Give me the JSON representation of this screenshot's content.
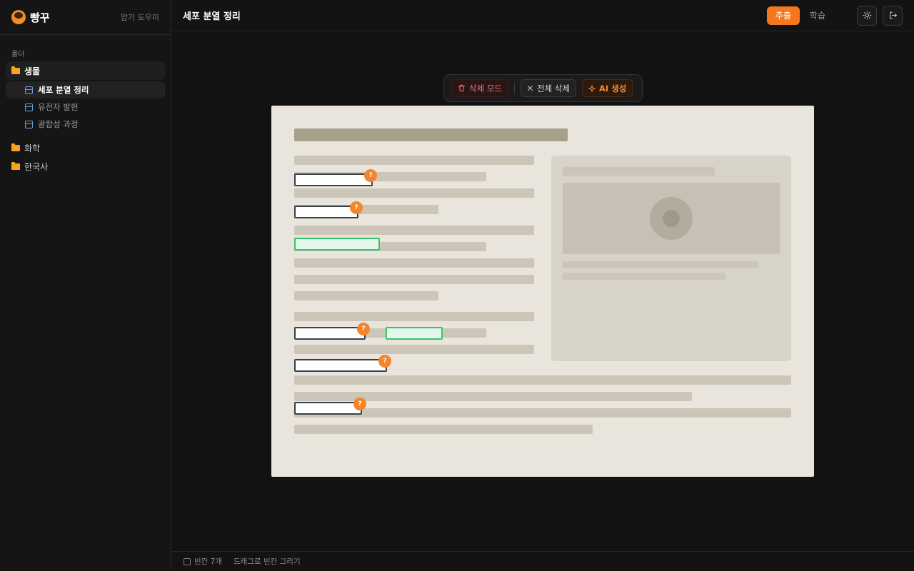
{
  "app": {
    "title": "빵꾸",
    "subtitle": "암기 도우미",
    "accent": "#f5781e"
  },
  "sidebar": {
    "section_label": "폴더",
    "folders": [
      {
        "label": "생물",
        "active": true,
        "notes": [
          {
            "label": "세포 분열 정리",
            "active": true
          },
          {
            "label": "유전자 발현",
            "active": false
          },
          {
            "label": "광합성 과정",
            "active": false
          }
        ]
      },
      {
        "label": "화학",
        "active": false
      },
      {
        "label": "한국사",
        "active": false
      }
    ]
  },
  "header": {
    "title": "세포 분열 정리",
    "modes": [
      {
        "label": "추출",
        "active": true
      },
      {
        "label": "학습",
        "active": false
      }
    ],
    "icons": [
      "sun-icon",
      "logout-icon"
    ]
  },
  "toolbar": {
    "delete_mode": "삭제 모드",
    "clear_all": "전체 삭제",
    "ai_generate": "AI 생성"
  },
  "document": {
    "badge_label": "?",
    "blank_count": 7
  },
  "footer": {
    "blank_count_label": "빈칸 7개",
    "hint": "드래그로 빈칸 그리기"
  }
}
